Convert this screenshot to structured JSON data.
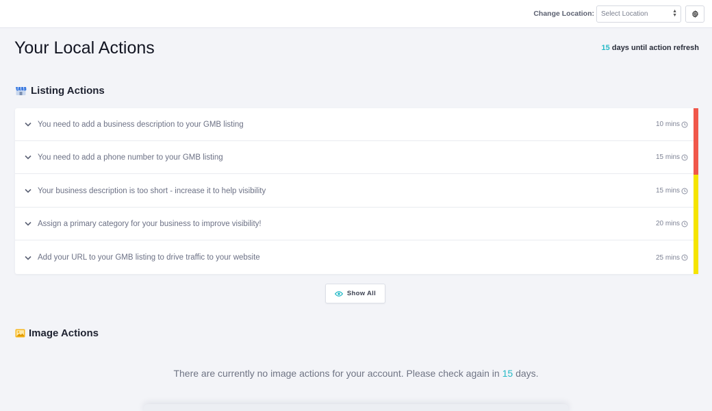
{
  "topbar": {
    "location_label": "Change Location:",
    "location_placeholder": "Select Location"
  },
  "header": {
    "title": "Your Local Actions",
    "refresh_days": "15",
    "refresh_text": " days until action refresh"
  },
  "listing": {
    "title": "Listing Actions",
    "items": [
      {
        "text": "You need to add a business description to your GMB listing",
        "time": "10 mins",
        "priority_color": "#f0574b"
      },
      {
        "text": "You need to add a phone number to your GMB listing",
        "time": "15 mins",
        "priority_color": "#f0574b"
      },
      {
        "text": "Your business description is too short - increase it to help visibility",
        "time": "15 mins",
        "priority_color": "#f5e400"
      },
      {
        "text": "Assign a primary category for your business to improve visibility!",
        "time": "20 mins",
        "priority_color": "#f5e400"
      },
      {
        "text": "Add your URL to your GMB listing to drive traffic to your website",
        "time": "25 mins",
        "priority_color": "#f5e400"
      }
    ],
    "show_all_label": "Show All"
  },
  "images": {
    "title": "Image Actions",
    "empty_prefix": "There are currently no image actions for your account. Please check again in ",
    "empty_days": "15",
    "empty_suffix": " days."
  },
  "colors": {
    "accent": "#25b9c6",
    "priority_high": "#f0574b",
    "priority_medium": "#f5e400"
  },
  "icons": {
    "listing": "storefront-icon",
    "images": "image-icon",
    "settings": "gear-icon",
    "expand": "chevron-down-icon",
    "time": "clock-icon",
    "show_all": "eye-icon"
  }
}
